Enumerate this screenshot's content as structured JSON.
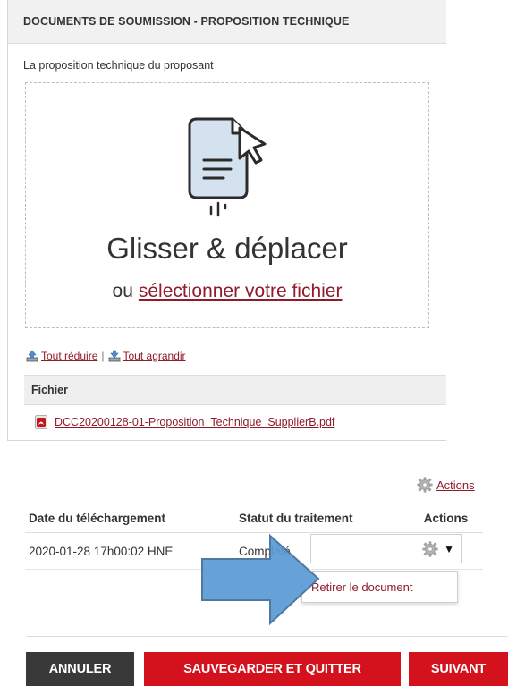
{
  "panel": {
    "title": "DOCUMENTS DE SOUMISSION - PROPOSITION TECHNIQUE",
    "subtitle": "La proposition technique du proposant",
    "dropzone": {
      "main_text": "Glisser & déplacer",
      "or_text": "ou",
      "select_link": "sélectionner votre fichier",
      "icon": "document-upload-icon"
    },
    "collapse_all": "Tout réduire",
    "separator": "|",
    "expand_all": "Tout agrandir",
    "file_table": {
      "header": "Fichier",
      "files": [
        {
          "name": "DCC20200128-01-Proposition_Technique_SupplierB.pdf",
          "icon": "pdf-icon"
        }
      ]
    }
  },
  "status_section": {
    "actions_link": "Actions",
    "columns": [
      "Date du téléchargement",
      "Statut du traitement",
      "Actions"
    ],
    "rows": [
      {
        "date": "2020-01-28 17h00:02 HNE",
        "status": "Complété"
      }
    ],
    "menu_item": "Retirer le document"
  },
  "buttons": {
    "cancel": "ANNULER",
    "save_quit": "SAUVEGARDER ET QUITTER",
    "next": "SUIVANT"
  },
  "colors": {
    "link": "#8f1b2b",
    "primary": "#d4121e",
    "dark": "#393939",
    "arrow": "#5b9bd5"
  }
}
